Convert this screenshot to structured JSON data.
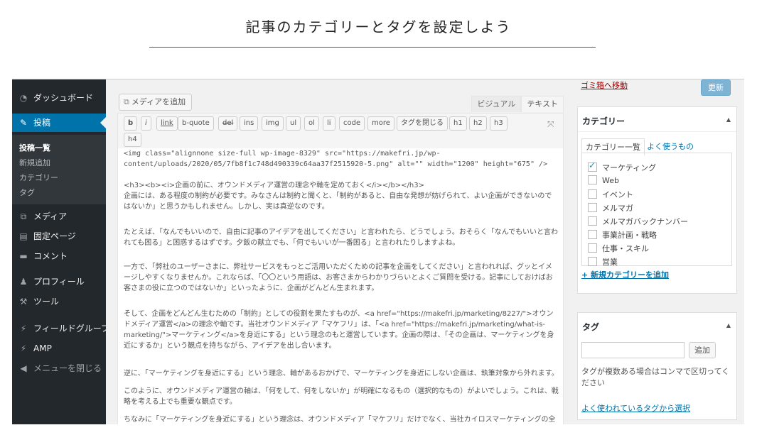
{
  "page": {
    "heading": "記事のカテゴリーとタグを設定しよう"
  },
  "sidebar": {
    "items": [
      {
        "label": "ダッシュボード",
        "icon": "dashboard-icon"
      },
      {
        "label": "投稿",
        "icon": "pin-icon"
      },
      {
        "label": "メディア",
        "icon": "media-icon"
      },
      {
        "label": "固定ページ",
        "icon": "page-icon"
      },
      {
        "label": "コメント",
        "icon": "comment-icon"
      },
      {
        "label": "プロフィール",
        "icon": "user-icon"
      },
      {
        "label": "ツール",
        "icon": "wrench-icon"
      },
      {
        "label": "フィールドグループ",
        "icon": "field-group-icon"
      },
      {
        "label": "AMP",
        "icon": "amp-icon"
      },
      {
        "label": "メニューを閉じる",
        "icon": "collapse-icon"
      }
    ],
    "submenu": [
      "投稿一覧",
      "新規追加",
      "カテゴリー",
      "タグ"
    ]
  },
  "editor": {
    "add_media": "メディアを追加",
    "tabs": [
      "ビジュアル",
      "テキスト"
    ],
    "quicktags": [
      "b",
      "i",
      "link",
      "b-quote",
      "del",
      "ins",
      "img",
      "ul",
      "ol",
      "li",
      "code",
      "more",
      "タグを閉じる",
      "h1",
      "h2",
      "h3",
      "h4"
    ],
    "content": {
      "img_line": "<img class=\"alignnone size-full wp-image-8329\" src=\"https://makefri.jp/wp-content/uploads/2020/05/7fb8f1c748d490339c64aa37f2515920-5.png\" alt=\"\" width=\"1200\" height=\"675\" />",
      "h3_line": "<h3><b><i>企画の前に、オウンドメディア運営の理念や軸を定めておく</i></b></h3>",
      "p1": "企画には、ある程度の制約が必要です。みなさんは制約と聞くと、「制約があると、自由な発想が妨げられて、よい企画ができないのではないか」と思うかもしれません。しかし、実は真逆なのです。",
      "p2": "たとえば、「なんでもいいので、自由に記事のアイデアを出してください」と言われたら、どうでしょう。おそらく「なんでもいいと言われても困る」と困惑するはずです。夕飯の献立でも、「何でもいいが一番困る」と言われたりしますよね。",
      "p3": "一方で、「弊社のユーザーさまに、弊社サービスをもっとご活用いただくための記事を企画をしてください」と言われれば、グッとイメージしやすくなりませんか。これならば、「〇〇という用語は、お客さまからわかりづらいとよくご質問を受ける。記事にしておけばお客さまの役に立つのではないか」といったように、企画がどんどん生まれます。",
      "p4": "そして、企画をどんどん生むための「制約」としての役割を果たすものが、<a href=\"https://makefri.jp/marketing/8227/\">オウンドメディア運営</a>の理念や軸です。当社オウンドメディア「マケフリ」は、「<a href=\"https://makefri.jp/marketing/what-is-marketing/\">マーケティング</a>を身近にする」という理念のもと運営しています。企画の際は、「その企画は、マーケティングを身近にするか」という観点を持ちながら、アイデアを出し合います。",
      "p5": "逆に、「マーケティングを身近にする」という理念、軸があるおかげで、マーケティングを身近にしない企画は、執筆対象から外れます。",
      "p6": "このように、オウンドメディア運営の軸は、「何をして、何をしないか」が明確になるもの（選択的なもの）がよいでしょう。これは、戦略を考える上でも重要な観点です。",
      "p7": "ちなみに「マーケティングを身近にする」という理念は、オウンドメディア「マケフリ」だけでなく、当社カイロスマーケティングの全社的なミッ"
    }
  },
  "publish": {
    "trash": "ゴミ箱へ移動",
    "update": "更新"
  },
  "categories": {
    "title": "カテゴリー",
    "tab_all": "カテゴリー一覧",
    "tab_popular": "よく使うもの",
    "items": [
      {
        "label": "マーケティング",
        "checked": true
      },
      {
        "label": "Web",
        "checked": false
      },
      {
        "label": "イベント",
        "checked": false
      },
      {
        "label": "メルマガ",
        "checked": false
      },
      {
        "label": "メルマガバックナンバー",
        "checked": false
      },
      {
        "label": "事業計画・戦略",
        "checked": false
      },
      {
        "label": "仕事・スキル",
        "checked": false
      },
      {
        "label": "営業",
        "checked": false
      }
    ],
    "add_new": "+ 新規カテゴリーを追加"
  },
  "tags": {
    "title": "タグ",
    "input_value": "",
    "add_button": "追加",
    "note": "タグが複数ある場合はコンマで区切ってください",
    "popular_link": "よく使われているタグから選択"
  }
}
